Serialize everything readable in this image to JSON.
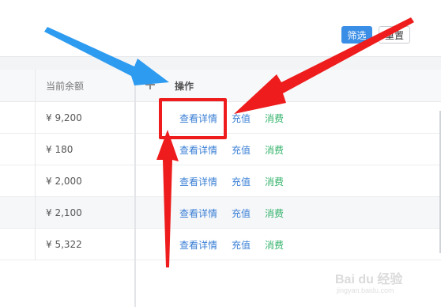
{
  "filter": {
    "filter_label": "筛选",
    "reset_label": "重置"
  },
  "table": {
    "columns": {
      "balance": "当前余额",
      "ops": "操作"
    },
    "rows": [
      {
        "balance": "¥ 9,200"
      },
      {
        "balance": "¥ 180"
      },
      {
        "balance": "¥ 2,000"
      },
      {
        "balance": "¥ 2,100"
      },
      {
        "balance": "¥ 5,322"
      }
    ],
    "actions": {
      "detail": "查看详情",
      "recharge": "充值",
      "consume": "消费"
    }
  },
  "annotations": {
    "arrow_color": "#ee1c1c",
    "blue_arrow_color": "#2d9bf0"
  },
  "watermark": {
    "text": "Bai du 经验",
    "url": "jingyan.baidu.com"
  }
}
